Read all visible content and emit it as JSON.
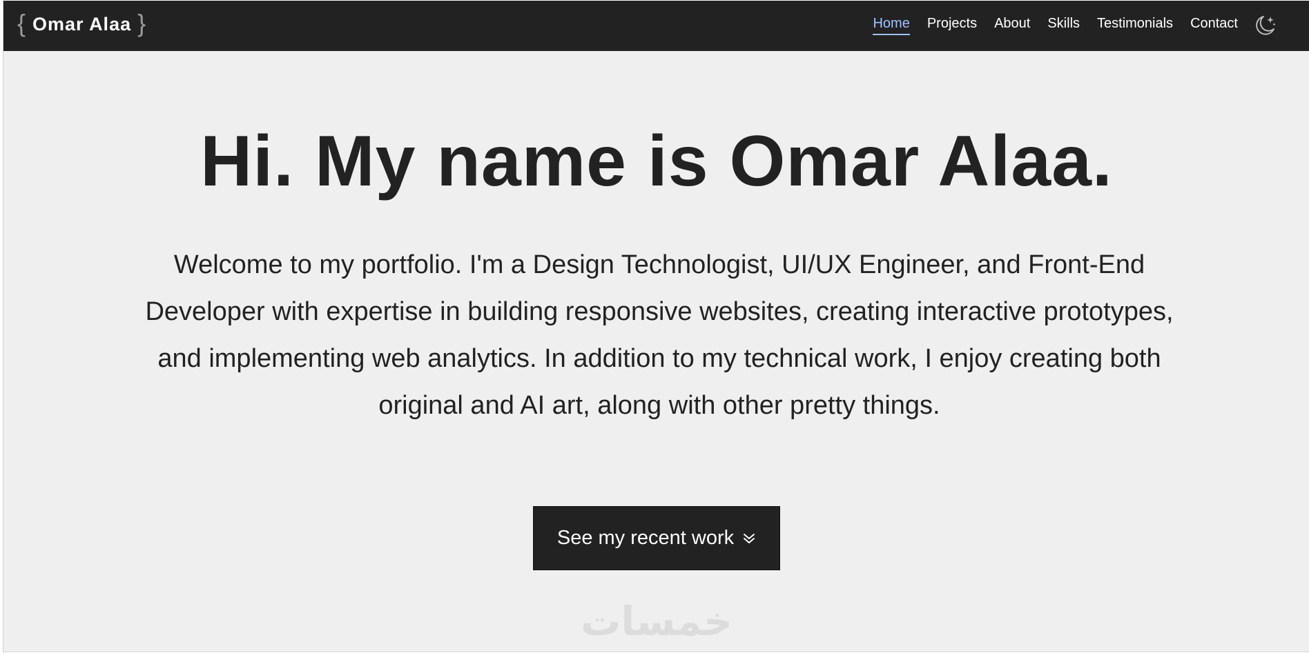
{
  "brand": {
    "open_brace": "{",
    "name": "Omar Alaa",
    "close_brace": "}"
  },
  "nav": {
    "items": [
      {
        "label": "Home",
        "active": true
      },
      {
        "label": "Projects",
        "active": false
      },
      {
        "label": "About",
        "active": false
      },
      {
        "label": "Skills",
        "active": false
      },
      {
        "label": "Testimonials",
        "active": false
      },
      {
        "label": "Contact",
        "active": false
      }
    ],
    "theme_toggle_icon": "moon-stars-icon"
  },
  "hero": {
    "title": "Hi. My name is Omar Alaa.",
    "intro": "Welcome to my portfolio. I'm a Design Technologist, UI/UX Engineer, and Front-End Developer with expertise in building responsive websites, creating interactive prototypes, and implementing web analytics. In addition to my technical work, I enjoy creating both original and AI art, along with other pretty things.",
    "cta_label": "See my recent work",
    "cta_icon": "double-chevron-down-icon"
  },
  "watermark": {
    "text": "خمسات"
  },
  "colors": {
    "navbar_bg": "#222222",
    "page_bg": "#efefef",
    "active_link": "#9ec3ff",
    "text": "#222222",
    "button_bg": "#222222"
  }
}
